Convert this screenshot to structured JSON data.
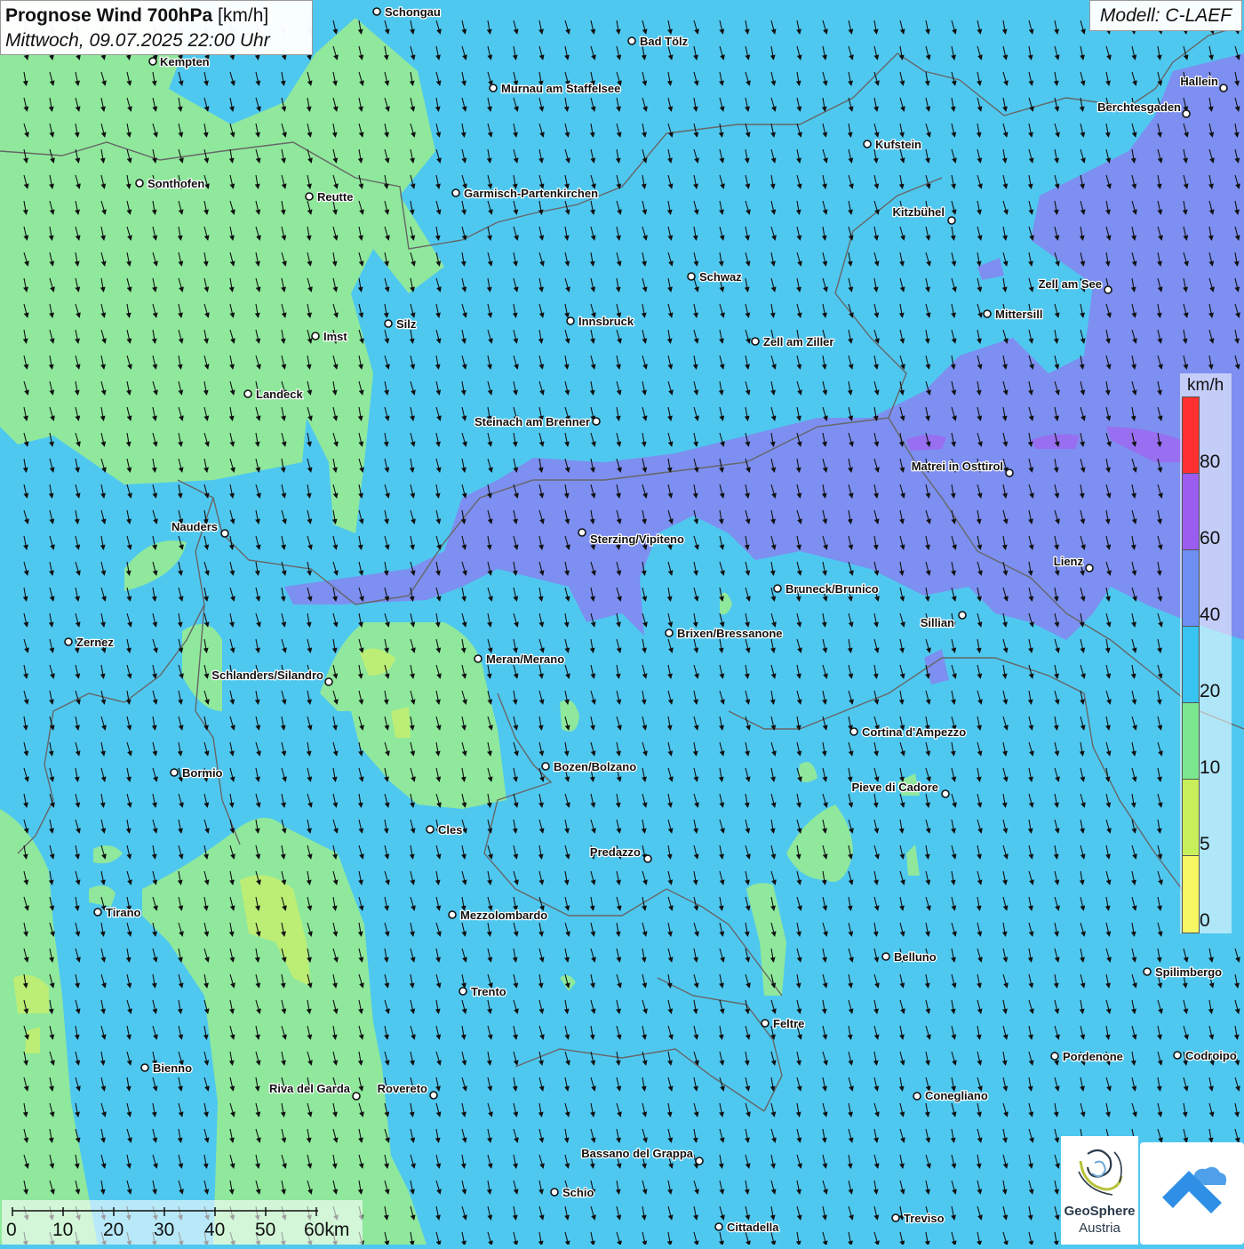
{
  "header": {
    "title_bold": "Prognose Wind 700hPa",
    "title_unit": "[km/h]",
    "datetime": "Mittwoch, 09.07.2025 22:00 Uhr"
  },
  "model_label": "Modell: C-LAEF",
  "legend": {
    "unit": "km/h",
    "ticks": [
      "80",
      "60",
      "40",
      "20",
      "10",
      "5",
      "0"
    ],
    "colors": [
      "#ff3030",
      "#9b5cf0",
      "#6f8ff2",
      "#38c3f0",
      "#7be890",
      "#c7ef5a",
      "#f7f763"
    ]
  },
  "scale_bar": {
    "labels": [
      "0",
      "10",
      "20",
      "30",
      "40",
      "50",
      "60km"
    ]
  },
  "logos": {
    "geosphere_name": "GeoSphere",
    "geosphere_sub": "Austria",
    "geosphere_colors": [
      "#2a3a4a",
      "#b8c23a",
      "#6fa9d8"
    ],
    "app_color": "#2f8fe6"
  },
  "map_colors": {
    "band_0_5": "#f2f26a",
    "band_5_10": "#c4ee70",
    "band_10_20": "#8fe89c",
    "band_20_40": "#4fc8f0",
    "band_40_60": "#7d8ff0",
    "band_60_80": "#9a6cf0",
    "border": "#666666",
    "arrow": "#111111"
  },
  "cities": [
    {
      "name": "Schongau"
    },
    {
      "name": "Kempten"
    },
    {
      "name": "Bad Tölz"
    },
    {
      "name": "Murnau am Staffelsee"
    },
    {
      "name": "Hallein"
    },
    {
      "name": "Berchtesgaden"
    },
    {
      "name": "Kufstein"
    },
    {
      "name": "Sonthofen"
    },
    {
      "name": "Reutte"
    },
    {
      "name": "Garmisch-Partenkirchen"
    },
    {
      "name": "Kitzbühel"
    },
    {
      "name": "Schwaz"
    },
    {
      "name": "Zell am See"
    },
    {
      "name": "Mittersill"
    },
    {
      "name": "Innsbruck"
    },
    {
      "name": "Imst"
    },
    {
      "name": "Silz"
    },
    {
      "name": "Zell am Ziller"
    },
    {
      "name": "Landeck"
    },
    {
      "name": "Steinach am Brenner"
    },
    {
      "name": "Matrei in Osttirol"
    },
    {
      "name": "Nauders"
    },
    {
      "name": "Sterzing/Vipiteno"
    },
    {
      "name": "Lienz"
    },
    {
      "name": "Bruneck/Brunico"
    },
    {
      "name": "Sillian"
    },
    {
      "name": "Zernez"
    },
    {
      "name": "Brixen/Bressanone"
    },
    {
      "name": "Meran/Merano"
    },
    {
      "name": "Schlanders/Silandro"
    },
    {
      "name": "Cortina d'Ampezzo"
    },
    {
      "name": "Bozen/Bolzano"
    },
    {
      "name": "Bormio"
    },
    {
      "name": "Pieve di Cadore"
    },
    {
      "name": "Cles"
    },
    {
      "name": "Predazzo"
    },
    {
      "name": "Tirano"
    },
    {
      "name": "Mezzolombardo"
    },
    {
      "name": "Belluno"
    },
    {
      "name": "Spilimbergo"
    },
    {
      "name": "Trento"
    },
    {
      "name": "Feltre"
    },
    {
      "name": "Pordenone"
    },
    {
      "name": "Codroipo"
    },
    {
      "name": "Bienno"
    },
    {
      "name": "Riva del Garda"
    },
    {
      "name": "Rovereto"
    },
    {
      "name": "Conegliano"
    },
    {
      "name": "Bassano del Grappa"
    },
    {
      "name": "Schio"
    },
    {
      "name": "Treviso"
    },
    {
      "name": "Cittadella"
    }
  ],
  "wind_direction": "north-to-south"
}
